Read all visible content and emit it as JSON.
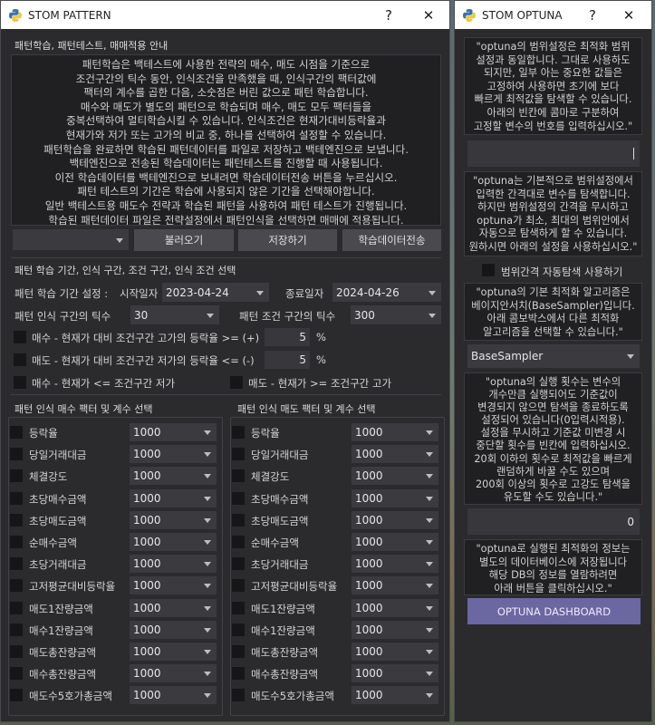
{
  "left": {
    "title": "STOM PATTERN",
    "help_btn": "?",
    "close_btn": "✕",
    "intro_title": "패턴학습, 패턴테스트, 매매적용 안내",
    "intro_text": "패턴학습은 백테스트에 사용한 전략의 매수, 매도 시점을 기준으로\n조건구간의 틱수 동안, 인식조건을 만족했을 때, 인식구간의 팩터값에\n팩터의 계수를 곱한 다음, 소숫점은 버린 값으로 패턴 학습합니다.\n매수와 매도가 별도의 패턴으로 학습되며 매수, 매도 모두 팩터들을\n중복선택하여 멀티학습시킬 수 있습니다. 인식조건은 현재가대비등락율과\n현재가와 저가 또는 고가의 비교 중, 하나를 선택하여 설정할 수 있습니다.\n패턴학습을 완료하면 학습된 패턴데이터를 파일로 저장하고 백테엔진으로 보냅니다.\n백테엔진으로 전송된 학습데이터는 패턴테스트를 진행할 때 사용됩니다.\n이전 학습데이터를 백테엔진으로 보내려면 학습데이터전송 버튼을 누르십시오.\n패턴 테스트의 기간은 학습에 사용되지 않은 기간을 선택해야합니다.\n일반 백테스트용 매도수 전략과 학습된 패턴을 사용하여 패턴 테스트가 진행됩니다.\n학습된 패턴데이터 파일은 전략설정에서 패턴인식을 선택하면 매매에 적용됩니다.",
    "file_combo": "",
    "load_btn": "불러오기",
    "save_btn": "저장하기",
    "send_btn": "학습데이터전송",
    "section2_title": "패턴 학습 기간, 인식 구간, 조건 구간, 인식 조건 선택",
    "period_label": "패턴 학습 기간 설정 :",
    "start_label": "시작일자",
    "start_date": "2023-04-24",
    "end_label": "종료일자",
    "end_date": "2024-04-26",
    "recog_ticks_label": "패턴 인식 구간의 틱수",
    "recog_ticks": "30",
    "cond_ticks_label": "패턴 조건 구간의 틱수",
    "cond_ticks": "300",
    "cond1_label": "매수 - 현재가 대비 조건구간 고가의 등락율 >= (+)",
    "cond1_value": "5",
    "cond2_label": "매도 - 현재가 대비 조건구간 저가의 등락율 <= (-)",
    "cond2_value": "5",
    "percent": "%",
    "cond3_label": "매수 - 현재가 <= 조건구간 저가",
    "cond4_label": "매도 - 현재가 >= 조건구간 고가",
    "buy_factors_title": "패턴 인식 매수 팩터 및 계수 선택",
    "sell_factors_title": "패턴 인식 매도 팩터 및 계수 선택",
    "buy_factors": [
      {
        "name": "등락율",
        "value": "1000"
      },
      {
        "name": "당일거래대금",
        "value": "1000"
      },
      {
        "name": "체결강도",
        "value": "1000"
      },
      {
        "name": "초당매수금액",
        "value": "1000"
      },
      {
        "name": "초당매도금액",
        "value": "1000"
      },
      {
        "name": "순매수금액",
        "value": "1000"
      },
      {
        "name": "초당거래대금",
        "value": "1000"
      },
      {
        "name": "고저평균대비등락율",
        "value": "1000"
      },
      {
        "name": "매도1잔량금액",
        "value": "1000"
      },
      {
        "name": "매수1잔량금액",
        "value": "1000"
      },
      {
        "name": "매도총잔량금액",
        "value": "1000"
      },
      {
        "name": "매수총잔량금액",
        "value": "1000"
      },
      {
        "name": "매도수5호가총금액",
        "value": "1000"
      }
    ],
    "sell_factors": [
      {
        "name": "등락율",
        "value": "1000"
      },
      {
        "name": "당일거래대금",
        "value": "1000"
      },
      {
        "name": "체결강도",
        "value": "1000"
      },
      {
        "name": "초당매수금액",
        "value": "1000"
      },
      {
        "name": "초당매도금액",
        "value": "1000"
      },
      {
        "name": "순매수금액",
        "value": "1000"
      },
      {
        "name": "초당거래대금",
        "value": "1000"
      },
      {
        "name": "고저평균대비등락율",
        "value": "1000"
      },
      {
        "name": "매도1잔량금액",
        "value": "1000"
      },
      {
        "name": "매수1잔량금액",
        "value": "1000"
      },
      {
        "name": "매도총잔량금액",
        "value": "1000"
      },
      {
        "name": "매수총잔량금액",
        "value": "1000"
      },
      {
        "name": "매도수5호가총금액",
        "value": "1000"
      }
    ]
  },
  "right": {
    "title": "STOM OPTUNA",
    "help_btn": "?",
    "close_btn": "✕",
    "text1": "\"optuna의 범위설정은 최적화 범위\n설정과 동일합니다. 그대로 사용하도\n되지만, 일부 아는 중요한 값들은\n고정하여 사용하면 초기에 보다\n빠르게 최적값을 탐색할 수 있습니다.\n아래의 빈칸에 콤마로 구분하여\n고정할 변수의 번호를 입력하십시오.\"",
    "fixed_vars_value": "",
    "text2": "\"optuna는 기본적으로 범위설정에서\n입력한 간격대로 변수를 탐색합니다.\n하지만 범위설정의 간격을 무시하고\noptuna가 최소, 최대의 범위안에서\n자동으로 탐색하게 할 수 있습니다.\n원하시면 아래의 설정을 사용하십시오.\"",
    "auto_range_label": "범위간격 자동탐색 사용하기",
    "text3": "\"optuna의 기본 최적화 알고리즘은\n베이지안서치(BaseSampler)입니다.\n아래 콤보박스에서 다른 최적화\n알고리즘을 선택할 수 있습니다.\"",
    "sampler": "BaseSampler",
    "text4": "\"optuna의 실행 횟수는 변수의\n개수만큼 실행되어도 기준값이\n변경되지 않으면 탐색을 종료하도록\n설정되어 있습니다(0입력시적용).\n설정을 무시하고 기준값 미변경 시\n중단할 횟수를 빈칸에 입력하십시오.\n20회 이하의 횟수로 최적값을 빠르게\n랜덤하게 바꿀 수도 있으며\n200회 이상의 횟수로 고강도 탐색을\n유도할 수도 있습니다.\"",
    "run_count": "0",
    "text5": "\"optuna로 실행된 최적화의 정보는\n별도의 데이터베이스에 저장됩니다\n해당 DB의 정보를 열람하려면\n아래 버튼을 클릭하십시오.\"",
    "dashboard_btn": "OPTUNA DASHBOARD"
  }
}
